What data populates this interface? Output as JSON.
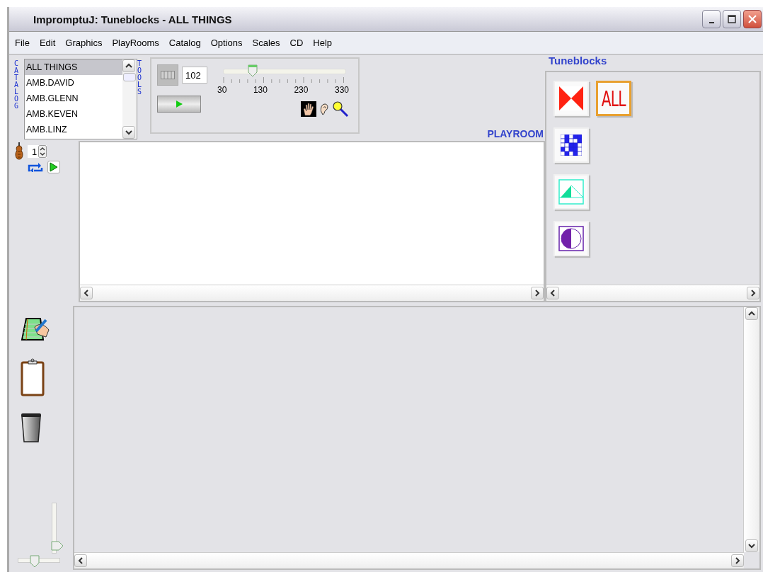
{
  "window": {
    "title": "ImpromptuJ: Tuneblocks - ALL THINGS"
  },
  "menu": [
    "File",
    "Edit",
    "Graphics",
    "PlayRooms",
    "Catalog",
    "Options",
    "Scales",
    "CD",
    "Help"
  ],
  "catalog": {
    "label": "CATALOG",
    "items": [
      {
        "label": "ALL THINGS",
        "selected": true
      },
      {
        "label": "AMB.DAVID",
        "selected": false
      },
      {
        "label": "AMB.GLENN",
        "selected": false
      },
      {
        "label": "AMB.KEVEN",
        "selected": false
      },
      {
        "label": "AMB.LINZ",
        "selected": false
      }
    ]
  },
  "tools": {
    "label": "TOOLS",
    "tempo": "102",
    "tempo_slider": {
      "level": 0.24,
      "tick_labels": [
        "30",
        "130",
        "230",
        "330"
      ]
    }
  },
  "playroom": {
    "label": "PLAYROOM",
    "voices": "1"
  },
  "tuneblocks": {
    "title": "Tuneblocks",
    "blocks": [
      {
        "kind": "hourglass",
        "selected": false
      },
      {
        "kind": "text",
        "label": "ALL",
        "selected": true
      },
      {
        "kind": "grid",
        "selected": false
      },
      {
        "kind": "triangle",
        "selected": false
      },
      {
        "kind": "circle",
        "selected": false
      }
    ]
  },
  "side_sliders": [
    {
      "kind": "vertical",
      "level": 0.15
    },
    {
      "kind": "horizontal",
      "level": 0.4
    }
  ]
}
